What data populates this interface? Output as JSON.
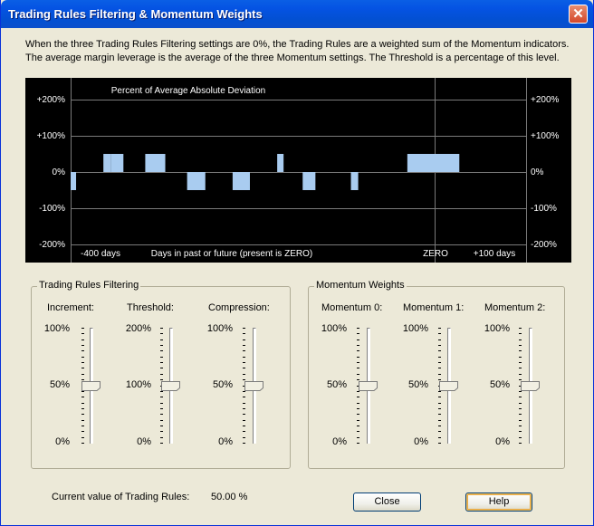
{
  "window": {
    "title": "Trading Rules Filtering & Momentum Weights",
    "close_glyph": "✕"
  },
  "description": [
    "When the three Trading Rules Filtering settings are 0%, the Trading Rules are a weighted sum of the Momentum indicators.",
    "The average margin leverage is the average of the three Momentum settings. The Threshold is a percentage of this level."
  ],
  "chart_data": {
    "type": "bar",
    "title": "Percent of Average Absolute Deviation",
    "xlabel": "Days in past or future (present is ZERO)",
    "x_tick_labels": [
      "-400 days",
      "ZERO",
      "+100 days"
    ],
    "y_tick_labels": [
      "+200%",
      "+100%",
      "0%",
      "-100%",
      "-200%"
    ],
    "xlim": [
      -400,
      100
    ],
    "ylim": [
      -200,
      200
    ],
    "grid": true,
    "bar_color": "#a9ccf0",
    "background_color": "#000000",
    "bars": [
      {
        "x0": -400,
        "x1": -394,
        "value": -50
      },
      {
        "x0": -364,
        "x1": -356,
        "value": 50
      },
      {
        "x0": -356,
        "x1": -342,
        "value": 50
      },
      {
        "x0": -318,
        "x1": -296,
        "value": 50
      },
      {
        "x0": -272,
        "x1": -252,
        "value": -50
      },
      {
        "x0": -222,
        "x1": -203,
        "value": -50
      },
      {
        "x0": -173,
        "x1": -166,
        "value": 50
      },
      {
        "x0": -145,
        "x1": -131,
        "value": -50
      },
      {
        "x0": -92,
        "x1": -84,
        "value": -50
      },
      {
        "x0": -30,
        "x1": 0,
        "value": 50
      },
      {
        "x0": 0,
        "x1": 27,
        "value": 50
      }
    ]
  },
  "filtering": {
    "label": "Trading Rules Filtering",
    "sliders": [
      {
        "label": "Increment:",
        "top": "100%",
        "mid": "50%",
        "bottom": "0%",
        "value_pct": 50
      },
      {
        "label": "Threshold:",
        "top": "200%",
        "mid": "100%",
        "bottom": "0%",
        "value_pct": 50
      },
      {
        "label": "Compression:",
        "top": "100%",
        "mid": "50%",
        "bottom": "0%",
        "value_pct": 50
      }
    ]
  },
  "momentum": {
    "label": "Momentum Weights",
    "sliders": [
      {
        "label": "Momentum 0:",
        "top": "100%",
        "mid": "50%",
        "bottom": "0%",
        "value_pct": 50
      },
      {
        "label": "Momentum 1:",
        "top": "100%",
        "mid": "50%",
        "bottom": "0%",
        "value_pct": 50
      },
      {
        "label": "Momentum 2:",
        "top": "100%",
        "mid": "50%",
        "bottom": "0%",
        "value_pct": 50
      }
    ]
  },
  "status": {
    "label": "Current value of Trading Rules:",
    "value": "50.00 %"
  },
  "buttons": {
    "close": "Close",
    "help": "Help"
  }
}
